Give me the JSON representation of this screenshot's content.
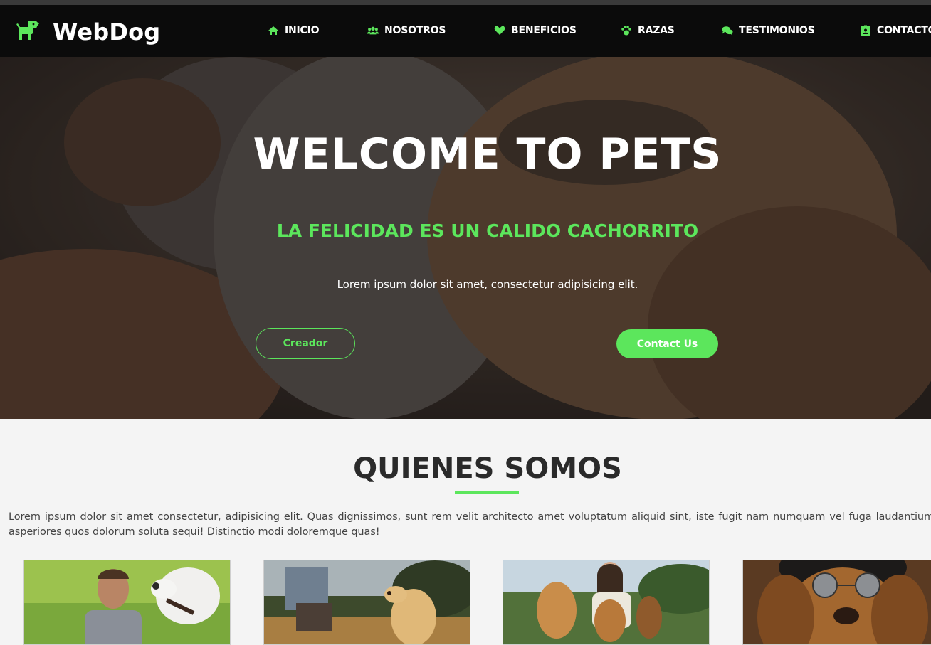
{
  "brand": {
    "name": "WebDog",
    "icon": "dog-icon",
    "accent": "#5ce65c"
  },
  "nav": {
    "items": [
      {
        "label": "INICIO",
        "icon": "home-icon"
      },
      {
        "label": "NOSOTROS",
        "icon": "users-icon"
      },
      {
        "label": "BENEFICIOS",
        "icon": "heart-icon"
      },
      {
        "label": "RAZAS",
        "icon": "paw-icon"
      },
      {
        "label": "TESTIMONIOS",
        "icon": "comments-icon"
      },
      {
        "label": "CONTACTO",
        "icon": "contact-card-icon"
      }
    ]
  },
  "hero": {
    "title": "WELCOME TO PETS",
    "subtitle": "LA FELICIDAD ES UN CALIDO CACHORRITO",
    "text": "Lorem ipsum dolor sit amet, consectetur adipisicing elit.",
    "primary_button": "Creador",
    "secondary_button": "Contact Us"
  },
  "about": {
    "title": "QUIENES SOMOS",
    "text": "Lorem ipsum dolor sit amet consectetur, adipisicing elit. Quas dignissimos, sunt rem velit architecto amet voluptatum aliquid sint, iste fugit nam numquam vel fuga laudantium asperiores quos dolorum soluta sequi! Distinctio modi doloremque quas!",
    "cards": [
      {
        "image": "man-with-white-dog-photo"
      },
      {
        "image": "man-training-dog-photo"
      },
      {
        "image": "woman-with-dogs-photo"
      },
      {
        "image": "dog-with-sunglasses-photo"
      }
    ]
  }
}
